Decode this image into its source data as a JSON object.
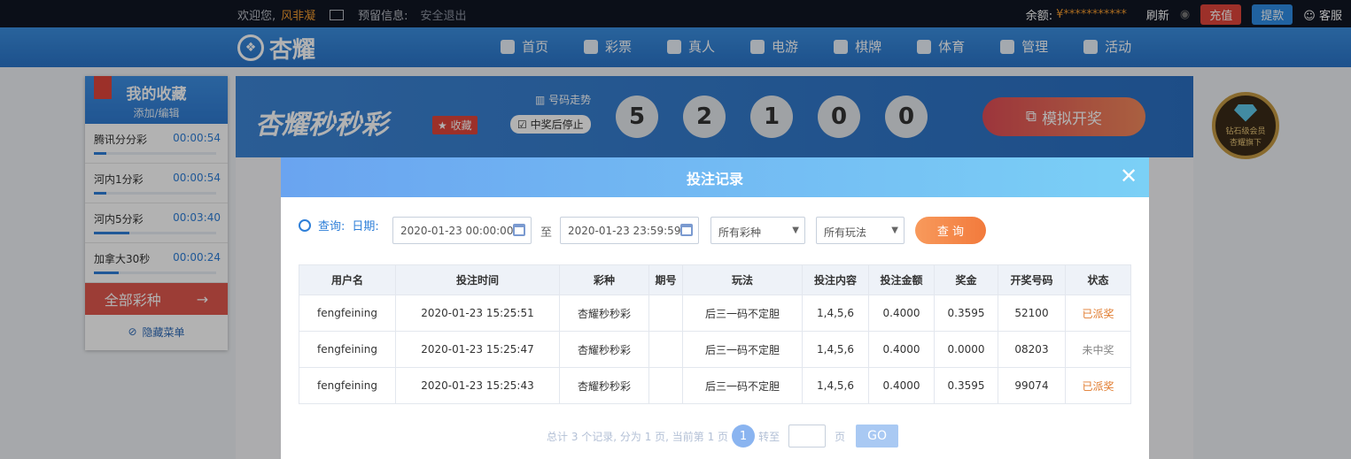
{
  "topbar": {
    "welcome": "欢迎您,",
    "username": "风非凝",
    "message": "预留信息:",
    "logout": "安全退出",
    "balance_label": "余额:",
    "balance": "¥***********",
    "refresh": "刷新",
    "recharge": "充值",
    "withdraw": "提款",
    "service": "客服"
  },
  "nav": {
    "logo": "杏耀",
    "items": [
      {
        "label": "首页"
      },
      {
        "label": "彩票"
      },
      {
        "label": "真人"
      },
      {
        "label": "电游"
      },
      {
        "label": "棋牌"
      },
      {
        "label": "体育"
      },
      {
        "label": "管理"
      },
      {
        "label": "活动"
      }
    ]
  },
  "favorites": {
    "title": "我的收藏",
    "edit": "添加/编辑",
    "items": [
      {
        "name": "腾讯分分彩",
        "time": "00:00:54"
      },
      {
        "name": "河内1分彩",
        "time": "00:00:54"
      },
      {
        "name": "河内5分彩",
        "time": "00:03:40"
      },
      {
        "name": "加拿大30秒",
        "time": "00:00:24"
      }
    ],
    "all": "全部彩种",
    "hide": "隐藏菜单"
  },
  "game": {
    "name": "杏耀秒秒彩",
    "fav": "收藏",
    "trend": "号码走势",
    "stop": "中奖后停止",
    "balls": [
      "5",
      "2",
      "1",
      "0",
      "0"
    ],
    "simulate": "模拟开奖"
  },
  "badge": {
    "line1": "钻石级会员",
    "line2": "杏耀旗下"
  },
  "modal": {
    "title": "投注记录",
    "query_label": "查询:",
    "date_label": "日期:",
    "start_date": "2020-01-23 00:00:00",
    "to": "至",
    "end_date": "2020-01-23 23:59:59",
    "lottery_select": "所有彩种",
    "play_select": "所有玩法",
    "query_button": "查 询",
    "columns": [
      "用户名",
      "投注时间",
      "彩种",
      "期号",
      "玩法",
      "投注内容",
      "投注金额",
      "奖金",
      "开奖号码",
      "状态"
    ],
    "rows": [
      {
        "user": "fengfeining",
        "time": "2020-01-23 15:25:51",
        "lottery": "杏耀秒秒彩",
        "issue": "",
        "play": "后三一码不定胆",
        "content": "1,4,5,6",
        "amount": "0.4000",
        "prize": "0.3595",
        "numbers": "52100",
        "status": "已派奖"
      },
      {
        "user": "fengfeining",
        "time": "2020-01-23 15:25:47",
        "lottery": "杏耀秒秒彩",
        "issue": "",
        "play": "后三一码不定胆",
        "content": "1,4,5,6",
        "amount": "0.4000",
        "prize": "0.0000",
        "numbers": "08203",
        "status": "未中奖"
      },
      {
        "user": "fengfeining",
        "time": "2020-01-23 15:25:43",
        "lottery": "杏耀秒秒彩",
        "issue": "",
        "play": "后三一码不定胆",
        "content": "1,4,5,6",
        "amount": "0.4000",
        "prize": "0.3595",
        "numbers": "99074",
        "status": "已派奖"
      }
    ],
    "pager": {
      "summary": "总计 3 个记录, 分为 1 页, 当前第 1 页",
      "current": "1",
      "goto": "转至",
      "page_unit": "页",
      "go": "GO"
    }
  },
  "colors": {
    "accent": "#2e7fd8",
    "paid": "#e07a2c",
    "query_btn": "#f27a3c"
  }
}
